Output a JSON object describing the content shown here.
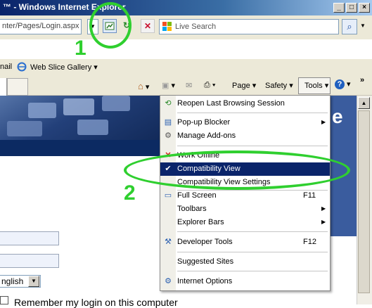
{
  "window": {
    "title": "™ - Windows Internet Explorer"
  },
  "address_bar": {
    "url": "nter/Pages/Login.aspx"
  },
  "search": {
    "placeholder": "Live Search",
    "go_label": "⌕"
  },
  "favorites_bar": {
    "email_label": "nail",
    "web_slice_label": "Web Slice Gallery ▾"
  },
  "command_bar": {
    "page_label": "Page",
    "safety_label": "Safety",
    "tools_label": "Tools"
  },
  "tools_menu": {
    "items": [
      {
        "label": "Reopen Last Browsing Session",
        "shortcut": "",
        "submenu": false,
        "icon": "reopen-icon"
      },
      {
        "label": "Pop-up Blocker",
        "shortcut": "",
        "submenu": true,
        "icon": "popup-blocker-icon"
      },
      {
        "label": "Manage Add-ons",
        "shortcut": "",
        "submenu": false,
        "icon": "addons-icon"
      },
      {
        "label": "Work Offline",
        "shortcut": "",
        "submenu": false,
        "icon": "offline-icon"
      },
      {
        "label": "Compatibility View",
        "shortcut": "",
        "submenu": false,
        "icon": "checkmark-icon",
        "checked": true,
        "highlighted": true
      },
      {
        "label": "Compatibility View Settings",
        "shortcut": "",
        "submenu": false,
        "icon": ""
      },
      {
        "label": "Full Screen",
        "shortcut": "F11",
        "submenu": false,
        "icon": "fullscreen-icon"
      },
      {
        "label": "Toolbars",
        "shortcut": "",
        "submenu": true,
        "icon": ""
      },
      {
        "label": "Explorer Bars",
        "shortcut": "",
        "submenu": true,
        "icon": ""
      },
      {
        "label": "Developer Tools",
        "shortcut": "F12",
        "submenu": false,
        "icon": "developer-tools-icon"
      },
      {
        "label": "Suggested Sites",
        "shortcut": "",
        "submenu": false,
        "icon": ""
      },
      {
        "label": "Internet Options",
        "shortcut": "",
        "submenu": false,
        "icon": "internet-options-icon"
      }
    ]
  },
  "page": {
    "banner_letter": "e",
    "language": "nglish",
    "remember_label": "Remember my login on this computer"
  },
  "annotations": {
    "label_1": "1",
    "label_2": "2"
  },
  "colors": {
    "annotation": "#2fcf2f",
    "menu_highlight": "#0a246a",
    "titlebar": "#0a246a"
  }
}
